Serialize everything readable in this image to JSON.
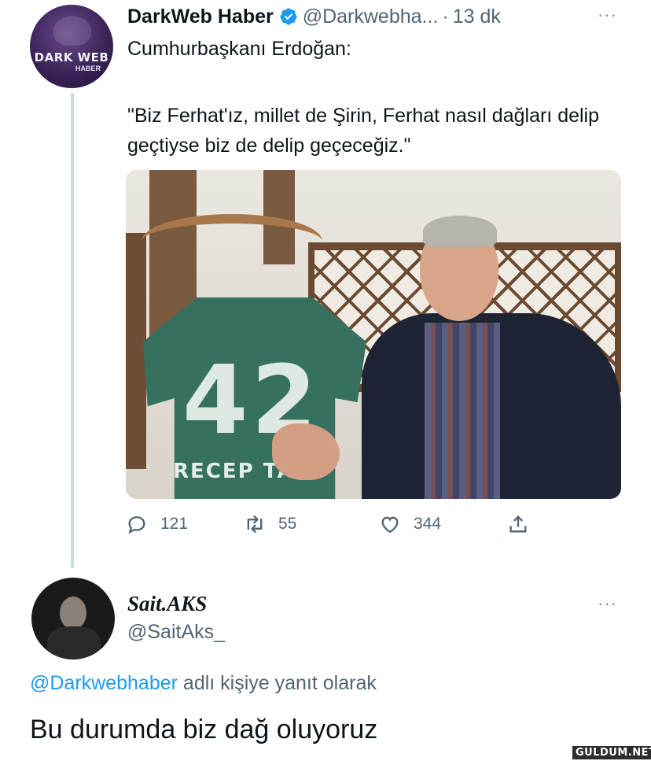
{
  "tweet": {
    "avatar_text": "DARK WEB",
    "avatar_sub": "HABER",
    "author_name": "DarkWeb Haber",
    "verified_color": "#1d9bf0",
    "handle": "@Darkwebha...",
    "separator": "·",
    "time": "13 dk",
    "more": "···",
    "line1": "Cumhurbaşkanı Erdoğan:",
    "quote": "\"Biz Ferhat'ız, millet de Şirin, Ferhat nasıl dağları delip geçtiyse biz de delip geçeceğiz.\"",
    "image": {
      "jersey_number": "42",
      "jersey_name": "RECEP TA"
    },
    "actions": {
      "reply_count": "121",
      "retweet_count": "55",
      "like_count": "344"
    }
  },
  "reply": {
    "author_name": "Sait.AKS",
    "handle": "@SaitAks_",
    "more": "···",
    "reply_to_handle": "@Darkwebhaber",
    "reply_to_suffix": " adlı kişiye yanıt olarak",
    "text": "Bu durumda biz dağ oluyoruz"
  },
  "watermark": "GULDUM.NET"
}
